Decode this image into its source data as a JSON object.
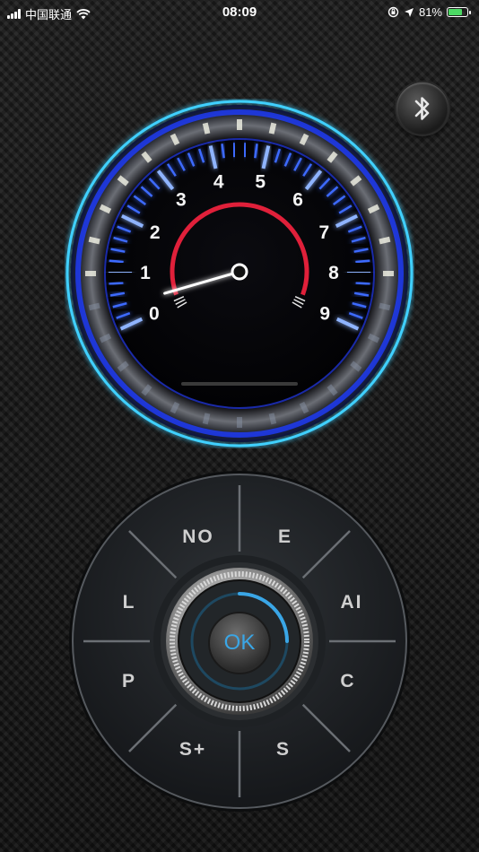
{
  "status_bar": {
    "carrier": "中国联通",
    "time": "08:09",
    "battery_percent": "81%",
    "battery_level": 0.81
  },
  "bluetooth": {
    "icon": "bluetooth-icon"
  },
  "gauge": {
    "scale_labels": [
      "0",
      "1",
      "2",
      "3",
      "4",
      "5",
      "6",
      "7",
      "8",
      "9"
    ],
    "needle_value": 0,
    "accent_color": "#1e6cff",
    "ring_color": "#3fd0ff",
    "redline_color": "#e0203a"
  },
  "pad": {
    "buttons": {
      "no": "NO",
      "e": "E",
      "ai": "AI",
      "c": "C",
      "s": "S",
      "s_plus": "S+",
      "p": "P",
      "l": "L"
    },
    "ok": "OK",
    "ok_color": "#3aa6e6"
  }
}
